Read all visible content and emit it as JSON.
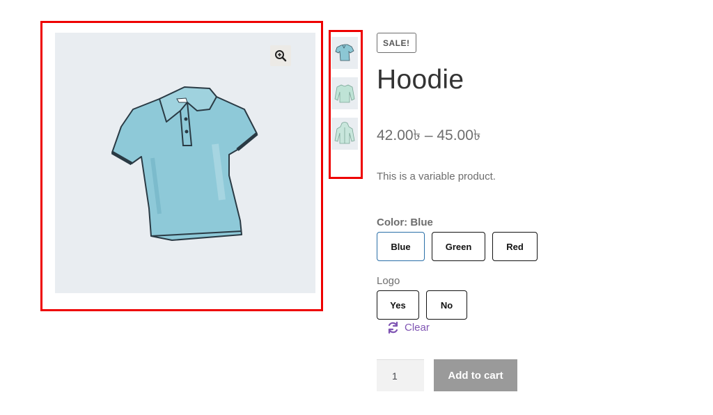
{
  "product": {
    "sale_badge": "SALE!",
    "title": "Hoodie",
    "price_range": "42.00৳ – 45.00৳",
    "short_description": "This is a variable product."
  },
  "gallery": {
    "main_image_icon": "polo-shirt-image",
    "zoom_icon": "zoom-in-icon",
    "thumbnails": [
      {
        "icon": "polo-shirt-thumbnail",
        "color": "#8cc7d4"
      },
      {
        "icon": "long-sleeve-shirt-thumbnail",
        "color": "#bfe3d6"
      },
      {
        "icon": "hoodie-thumbnail",
        "color": "#c8e6dc"
      }
    ]
  },
  "attributes": {
    "color": {
      "label": "Color:",
      "selected_value": "Blue",
      "options": [
        "Blue",
        "Green",
        "Red"
      ]
    },
    "logo": {
      "label": "Logo",
      "options": [
        "Yes",
        "No"
      ]
    },
    "clear_label": "Clear"
  },
  "cart": {
    "quantity": "1",
    "add_to_cart_label": "Add to cart"
  },
  "colors": {
    "highlight_border": "#ee0000",
    "selected_swatch_border": "#2a6fa8",
    "clear_link": "#7f54b3",
    "button_disabled": "#9a9a9a"
  }
}
